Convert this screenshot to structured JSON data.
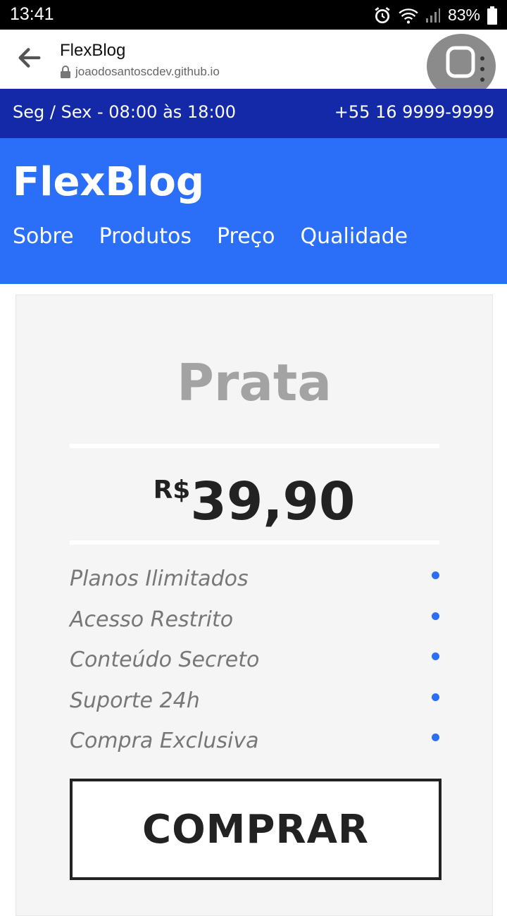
{
  "status_bar": {
    "time": "13:41",
    "battery": "83%"
  },
  "browser": {
    "title": "FlexBlog",
    "url": "joaodosantoscdev.github.io"
  },
  "topbar": {
    "hours": "Seg / Sex - 08:00 às 18:00",
    "phone": "+55 16 9999-9999"
  },
  "header": {
    "brand": "FlexBlog",
    "nav": [
      "Sobre",
      "Produtos",
      "Preço",
      "Qualidade"
    ]
  },
  "card": {
    "plan_name": "Prata",
    "currency": "R$",
    "price": "39,90",
    "features": [
      "Planos Ilimitados",
      "Acesso Restrito",
      "Conteúdo Secreto",
      "Suporte 24h",
      "Compra Exclusiva"
    ],
    "buy_label": "COMPRAR"
  },
  "colors": {
    "accent": "#2b6ef8",
    "topbar": "#1429a8"
  }
}
